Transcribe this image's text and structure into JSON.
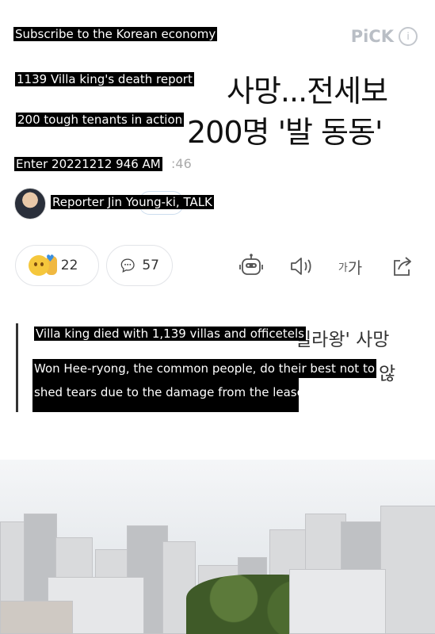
{
  "header": {
    "subscribe_label": "Subscribe to the Korean economy",
    "pick_logo_text": "PiCK",
    "pick_info_glyph": "i"
  },
  "article": {
    "title_line1": "1139 Villa king's death report",
    "title_line2": "200 tough tenants in action",
    "title_ghost_line1_korean": "사망...전세보",
    "title_ghost_line2_korean": "200명 '발 동동'",
    "date_text": "Enter 20221212 946 AM",
    "date_ghost_suffix": ":46",
    "reporter_name": "Reporter Jin Young-ki, TALK"
  },
  "reactions": {
    "emoji_count": "22",
    "comment_count": "57"
  },
  "tools": {
    "fontsize_small": "가",
    "fontsize_large": "가"
  },
  "summary": {
    "line1": "Villa king died with 1,139 villas and officetels",
    "line1_ghost_korean": "빌라왕' 사망",
    "line2": "Won Hee-ryong, the common people, do their best not to",
    "line2_ghost_korean": "않",
    "line3": "shed tears due to the damage from the lease"
  }
}
